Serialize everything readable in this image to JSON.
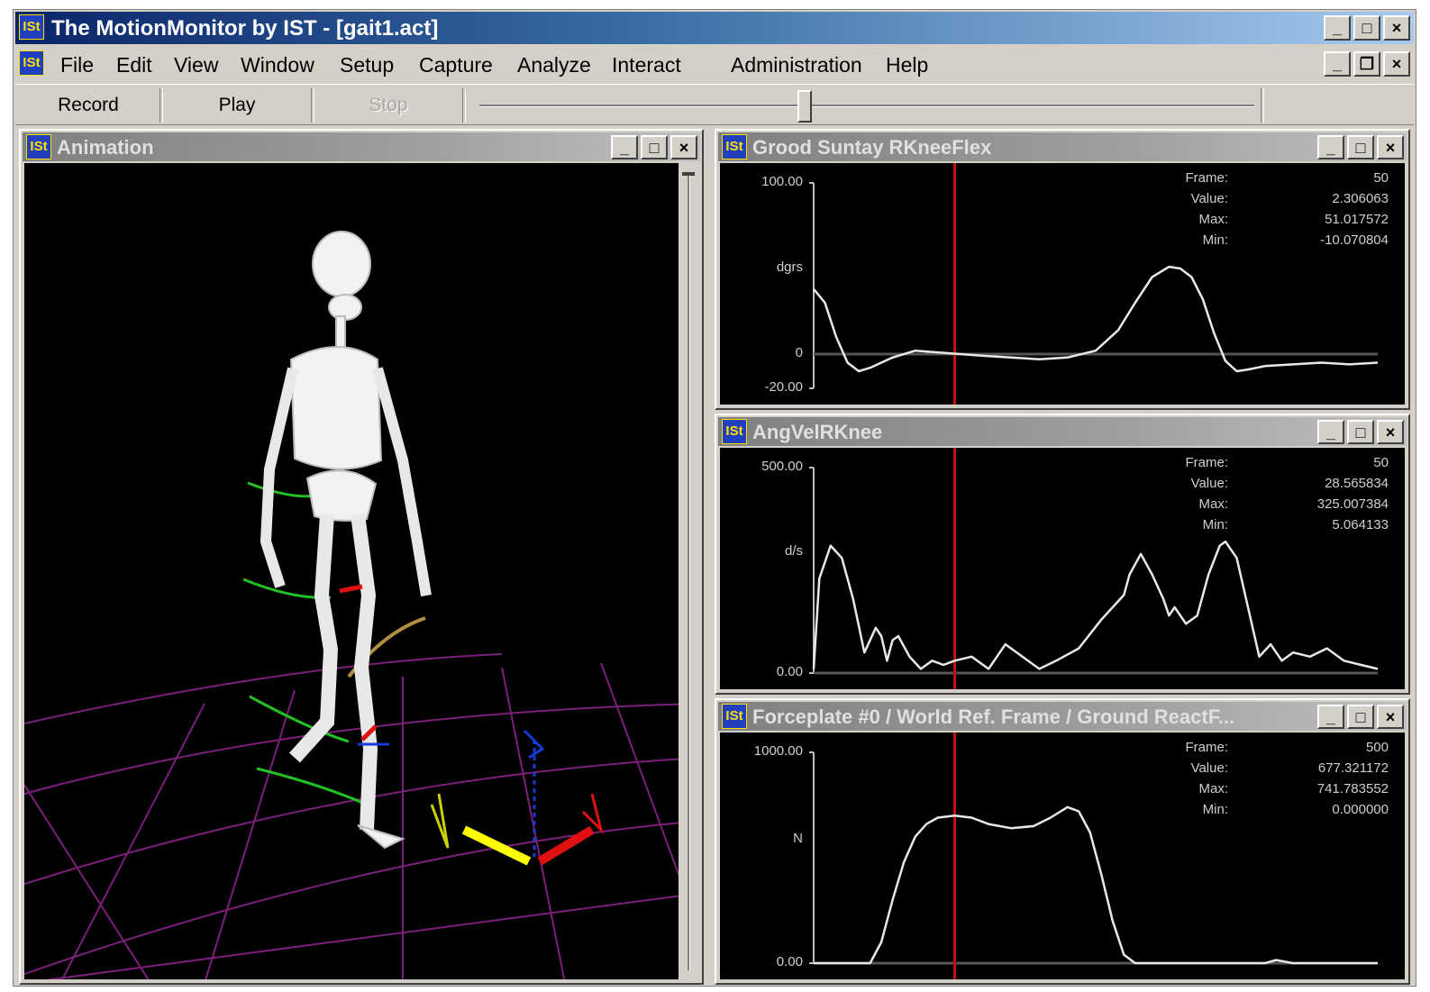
{
  "window": {
    "title": "The MotionMonitor by IST - [gait1.act]",
    "icon_label": "ISt"
  },
  "menu": [
    "File",
    "Edit",
    "View",
    "Window",
    "Setup",
    "Capture",
    "Analyze",
    "Interact",
    "Administration",
    "Help"
  ],
  "toolbar": {
    "record_label": "Record",
    "play_label": "Play",
    "stop_label": "Stop",
    "stop_enabled": false
  },
  "timeline": {
    "position": 0.42
  },
  "animation": {
    "title": "Animation",
    "grid_color": "#7a1f7a"
  },
  "graphs": [
    {
      "title": "Grood Suntay RKneeFlex",
      "ymax_label": "100.00",
      "unit": "dgrs",
      "zero_label": "0",
      "ymin_label": "-20.00",
      "info": [
        {
          "label": "Frame:",
          "value": "50"
        },
        {
          "label": "Value:",
          "value": "2.306063"
        },
        {
          "label": "Max:",
          "value": "51.017572"
        },
        {
          "label": "Min:",
          "value": "-10.070804"
        }
      ],
      "chart_data": {
        "type": "line",
        "xlim": [
          0,
          100
        ],
        "ylim": [
          -20,
          100
        ],
        "cursor_x": 25,
        "x": [
          0,
          2,
          4,
          6,
          8,
          10,
          14,
          18,
          22,
          26,
          30,
          35,
          40,
          45,
          50,
          54,
          57,
          60,
          63,
          65,
          67,
          69,
          71,
          73,
          75,
          77,
          80,
          85,
          90,
          95,
          100
        ],
        "y": [
          38,
          30,
          10,
          -5,
          -10,
          -8,
          -2,
          2,
          1,
          0,
          -1,
          -2,
          -3,
          -2,
          2,
          14,
          30,
          45,
          51,
          50,
          45,
          32,
          12,
          -4,
          -10,
          -9,
          -7,
          -6,
          -5,
          -6,
          -5
        ]
      }
    },
    {
      "title": "AngVelRKnee",
      "ymax_label": "500.00",
      "unit": "d/s",
      "ymin_label": "0.00",
      "info": [
        {
          "label": "Frame:",
          "value": "50"
        },
        {
          "label": "Value:",
          "value": "28.565834"
        },
        {
          "label": "Max:",
          "value": "325.007384"
        },
        {
          "label": "Min:",
          "value": "5.064133"
        }
      ],
      "chart_data": {
        "type": "line",
        "xlim": [
          0,
          100
        ],
        "ylim": [
          0,
          500
        ],
        "cursor_x": 25,
        "x": [
          0,
          1,
          3,
          5,
          7,
          9,
          11,
          12,
          13,
          14,
          15,
          17,
          19,
          21,
          23,
          25,
          28,
          31,
          34,
          37,
          40,
          43,
          47,
          51,
          55,
          56,
          58,
          60,
          62,
          63,
          64,
          66,
          68,
          70,
          72,
          73,
          75,
          77,
          79,
          81,
          83,
          85,
          88,
          91,
          94,
          97,
          100
        ],
        "y": [
          10,
          230,
          310,
          280,
          180,
          50,
          110,
          90,
          30,
          80,
          90,
          40,
          10,
          30,
          20,
          30,
          40,
          10,
          70,
          40,
          10,
          30,
          60,
          130,
          190,
          240,
          290,
          240,
          180,
          140,
          160,
          120,
          140,
          240,
          310,
          320,
          280,
          160,
          40,
          70,
          30,
          50,
          40,
          60,
          30,
          20,
          10
        ]
      }
    },
    {
      "title": "Forceplate #0 / World Ref. Frame / Ground ReactF...",
      "ymax_label": "1000.00",
      "unit": "N",
      "ymin_label": "0.00",
      "info": [
        {
          "label": "Frame:",
          "value": "500"
        },
        {
          "label": "Value:",
          "value": "677.321172"
        },
        {
          "label": "Max:",
          "value": "741.783552"
        },
        {
          "label": "Min:",
          "value": "0.000000"
        }
      ],
      "chart_data": {
        "type": "line",
        "xlim": [
          0,
          100
        ],
        "ylim": [
          0,
          1000
        ],
        "cursor_x": 25,
        "x": [
          0,
          5,
          10,
          12,
          14,
          16,
          18,
          20,
          22,
          25,
          28,
          31,
          35,
          39,
          42,
          45,
          47,
          49,
          51,
          53,
          55,
          57,
          60,
          65,
          70,
          80,
          82,
          83,
          85,
          90,
          95,
          100
        ],
        "y": [
          0,
          0,
          0,
          100,
          300,
          480,
          600,
          660,
          690,
          700,
          690,
          660,
          640,
          650,
          690,
          740,
          720,
          620,
          420,
          200,
          40,
          0,
          0,
          0,
          0,
          0,
          15,
          10,
          0,
          0,
          0,
          0
        ]
      }
    }
  ]
}
